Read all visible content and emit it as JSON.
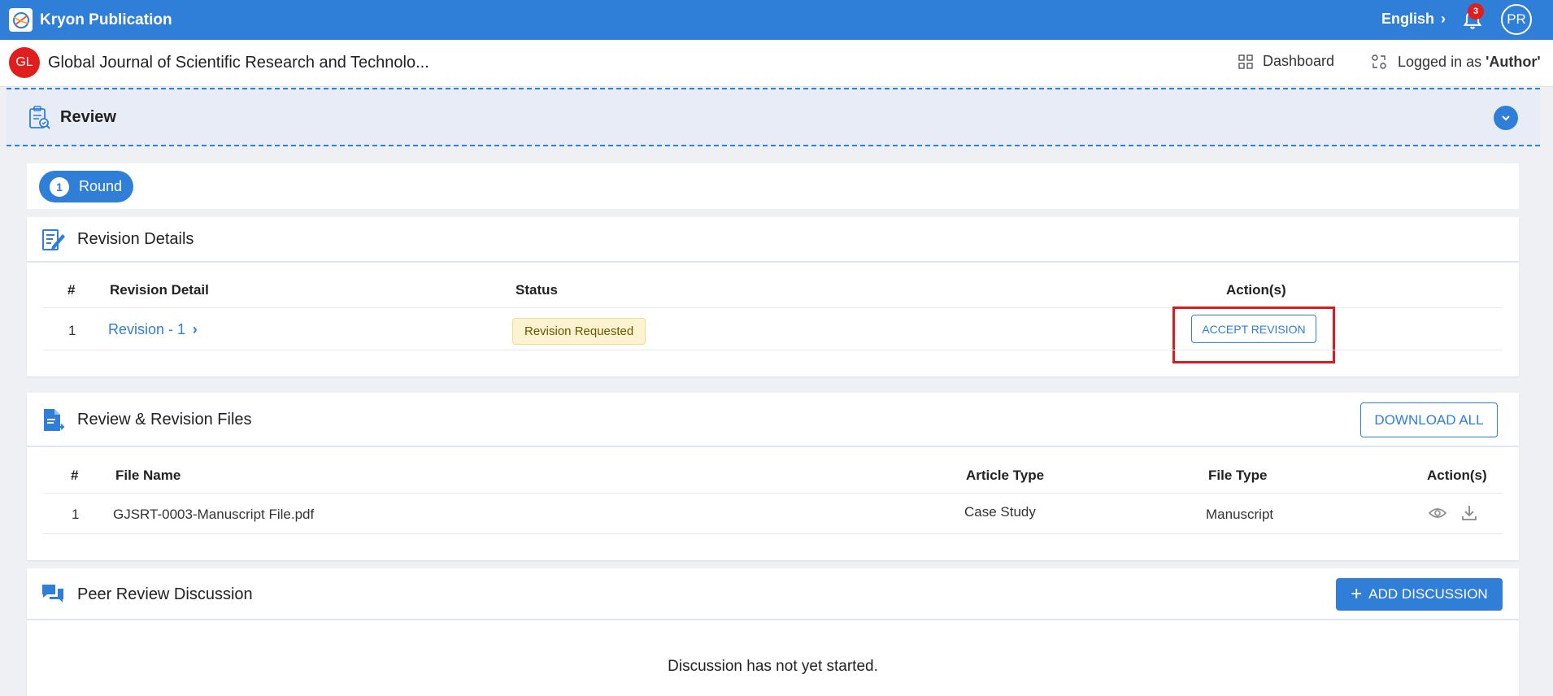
{
  "app": {
    "name": "Kryon Publication",
    "language": "English",
    "notification_count": "3",
    "user_initials": "PR"
  },
  "journal": {
    "initials": "GL",
    "title": "Global Journal of Scientific Research and Technolo..."
  },
  "nav": {
    "dashboard_label": "Dashboard",
    "logged_prefix": "Logged in as",
    "logged_role": "'Author'"
  },
  "review": {
    "title": "Review"
  },
  "round": {
    "number": "1",
    "label": "Round"
  },
  "revision_details": {
    "title": "Revision Details",
    "headers": {
      "num": "#",
      "detail": "Revision Detail",
      "status": "Status",
      "actions": "Action(s)"
    },
    "rows": [
      {
        "num": "1",
        "detail": "Revision - 1",
        "status": "Revision Requested",
        "action": "ACCEPT REVISION"
      }
    ]
  },
  "files": {
    "title": "Review & Revision Files",
    "download_all": "DOWNLOAD ALL",
    "headers": {
      "num": "#",
      "file_name": "File Name",
      "article_type": "Article Type",
      "file_type": "File Type",
      "actions": "Action(s)"
    },
    "rows": [
      {
        "num": "1",
        "file_name": "GJSRT-0003-Manuscript File.pdf",
        "article_type": "Case Study",
        "file_type": "Manuscript"
      }
    ]
  },
  "discussion": {
    "title": "Peer Review Discussion",
    "add_label": "ADD DISCUSSION",
    "empty_message": "Discussion has not yet started."
  },
  "colors": {
    "primary": "#2f7ed8",
    "danger": "#e0191f",
    "badge_bg": "#fdf3d0"
  }
}
